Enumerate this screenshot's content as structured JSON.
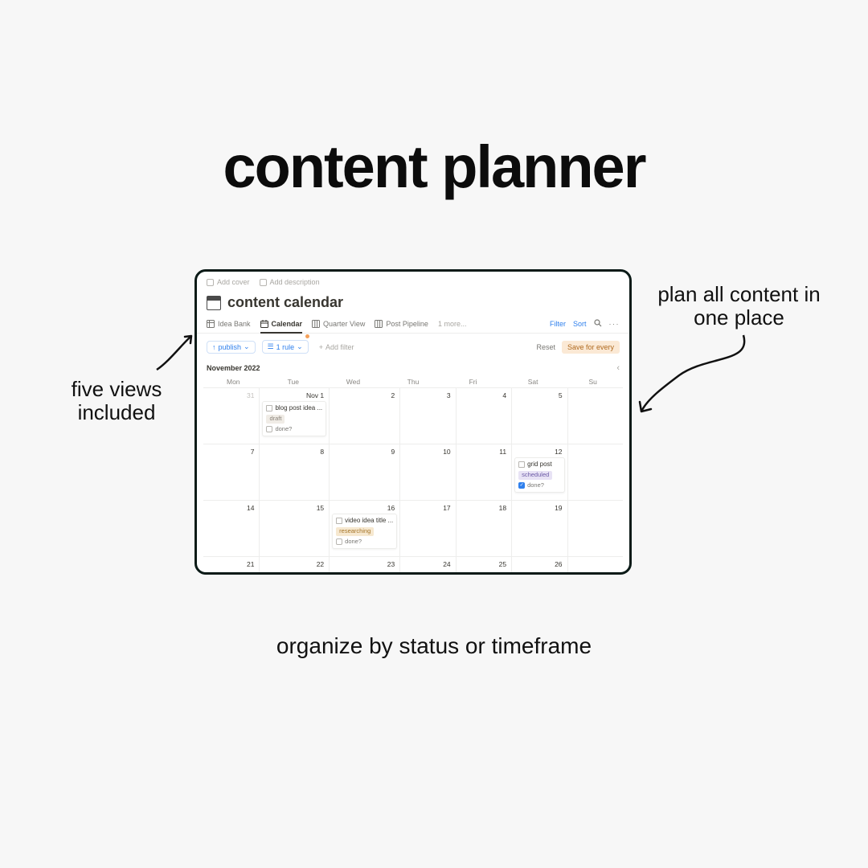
{
  "promo": {
    "heading": "content planner",
    "annot_left": "five views included",
    "annot_right": "plan all content in one place",
    "tagline": "organize by status or timeframe"
  },
  "header": {
    "add_cover": "Add cover",
    "add_description": "Add description"
  },
  "page": {
    "title": "content calendar"
  },
  "tabs": {
    "items": [
      {
        "label": "Idea Bank",
        "icon": "table-icon"
      },
      {
        "label": "Calendar",
        "icon": "calendar-icon",
        "active": true
      },
      {
        "label": "Quarter View",
        "icon": "board-icon"
      },
      {
        "label": "Post Pipeline",
        "icon": "board-icon"
      }
    ],
    "more": "1 more...",
    "filter": "Filter",
    "sort": "Sort"
  },
  "filterbar": {
    "publish": "publish",
    "rule": "1 rule",
    "add_filter": "Add filter",
    "reset": "Reset",
    "save": "Save for every"
  },
  "calendar": {
    "month": "November 2022",
    "dow": [
      "Mon",
      "Tue",
      "Wed",
      "Thu",
      "Fri",
      "Sat",
      "Su"
    ],
    "cells": [
      {
        "n": "31",
        "mute": true
      },
      {
        "n": "Nov 1",
        "first": true,
        "card": {
          "title": "blog post idea ...",
          "tag": "draft",
          "done": false,
          "done_label": "done?"
        }
      },
      {
        "n": "2"
      },
      {
        "n": "3"
      },
      {
        "n": "4"
      },
      {
        "n": "5"
      },
      {
        "n": ""
      },
      {
        "n": "7"
      },
      {
        "n": "8"
      },
      {
        "n": "9"
      },
      {
        "n": "10"
      },
      {
        "n": "11"
      },
      {
        "n": "12",
        "card": {
          "title": "grid post",
          "tag": "scheduled",
          "done": true,
          "done_label": "done?"
        }
      },
      {
        "n": ""
      },
      {
        "n": "14"
      },
      {
        "n": "15"
      },
      {
        "n": "16",
        "card": {
          "title": "video idea title ...",
          "tag": "researching",
          "done": false,
          "done_label": "done?"
        }
      },
      {
        "n": "17"
      },
      {
        "n": "18"
      },
      {
        "n": "19"
      },
      {
        "n": ""
      },
      {
        "n": "21"
      },
      {
        "n": "22"
      },
      {
        "n": "23"
      },
      {
        "n": "24"
      },
      {
        "n": "25"
      },
      {
        "n": "26"
      },
      {
        "n": ""
      }
    ]
  }
}
